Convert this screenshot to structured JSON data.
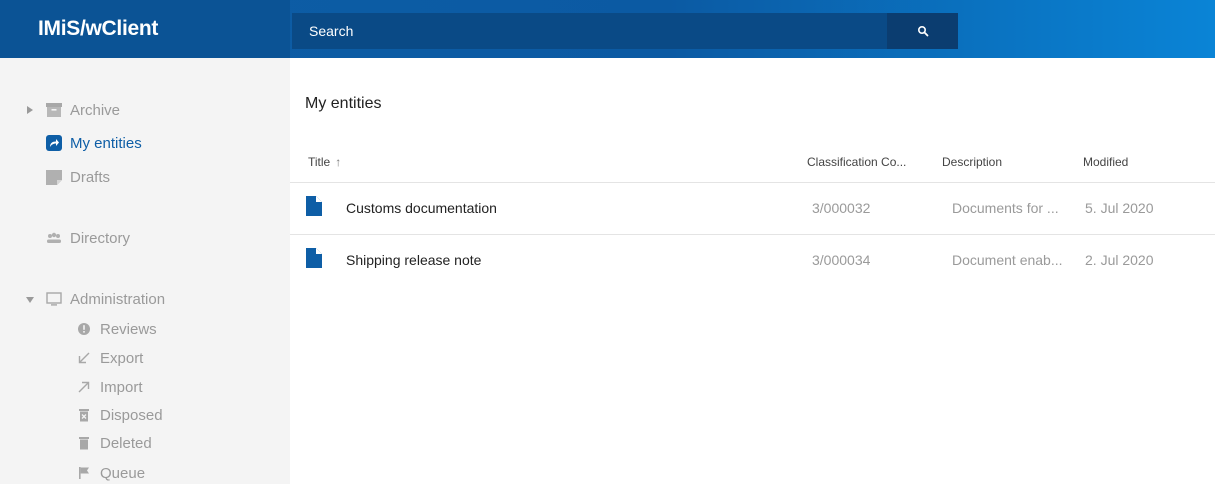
{
  "app": {
    "brand": "IMiS/wClient"
  },
  "search": {
    "placeholder": "Search",
    "button_icon": "search-icon"
  },
  "sidebar": {
    "archive": "Archive",
    "my_entities": "My entities",
    "drafts": "Drafts",
    "directory": "Directory",
    "administration": "Administration",
    "admin_items": {
      "reviews": "Reviews",
      "export": "Export",
      "import": "Import",
      "disposed": "Disposed",
      "deleted": "Deleted",
      "queue": "Queue"
    }
  },
  "main": {
    "title": "My entities",
    "columns": {
      "title": "Title",
      "title_sort": "↑",
      "classification": "Classification Co...",
      "description": "Description",
      "modified": "Modified"
    },
    "rows": [
      {
        "title": "Customs documentation",
        "classification": "3/000032",
        "description": "Documents for ...",
        "modified": "5. Jul 2020"
      },
      {
        "title": "Shipping release note",
        "classification": "3/000034",
        "description": "Document enab...",
        "modified": "2. Jul 2020"
      }
    ]
  },
  "colors": {
    "header": "#0e5ea6",
    "accent": "#0e5ea6",
    "sidebar_bg": "#f4f4f4",
    "muted_text": "#9a9a9a"
  }
}
